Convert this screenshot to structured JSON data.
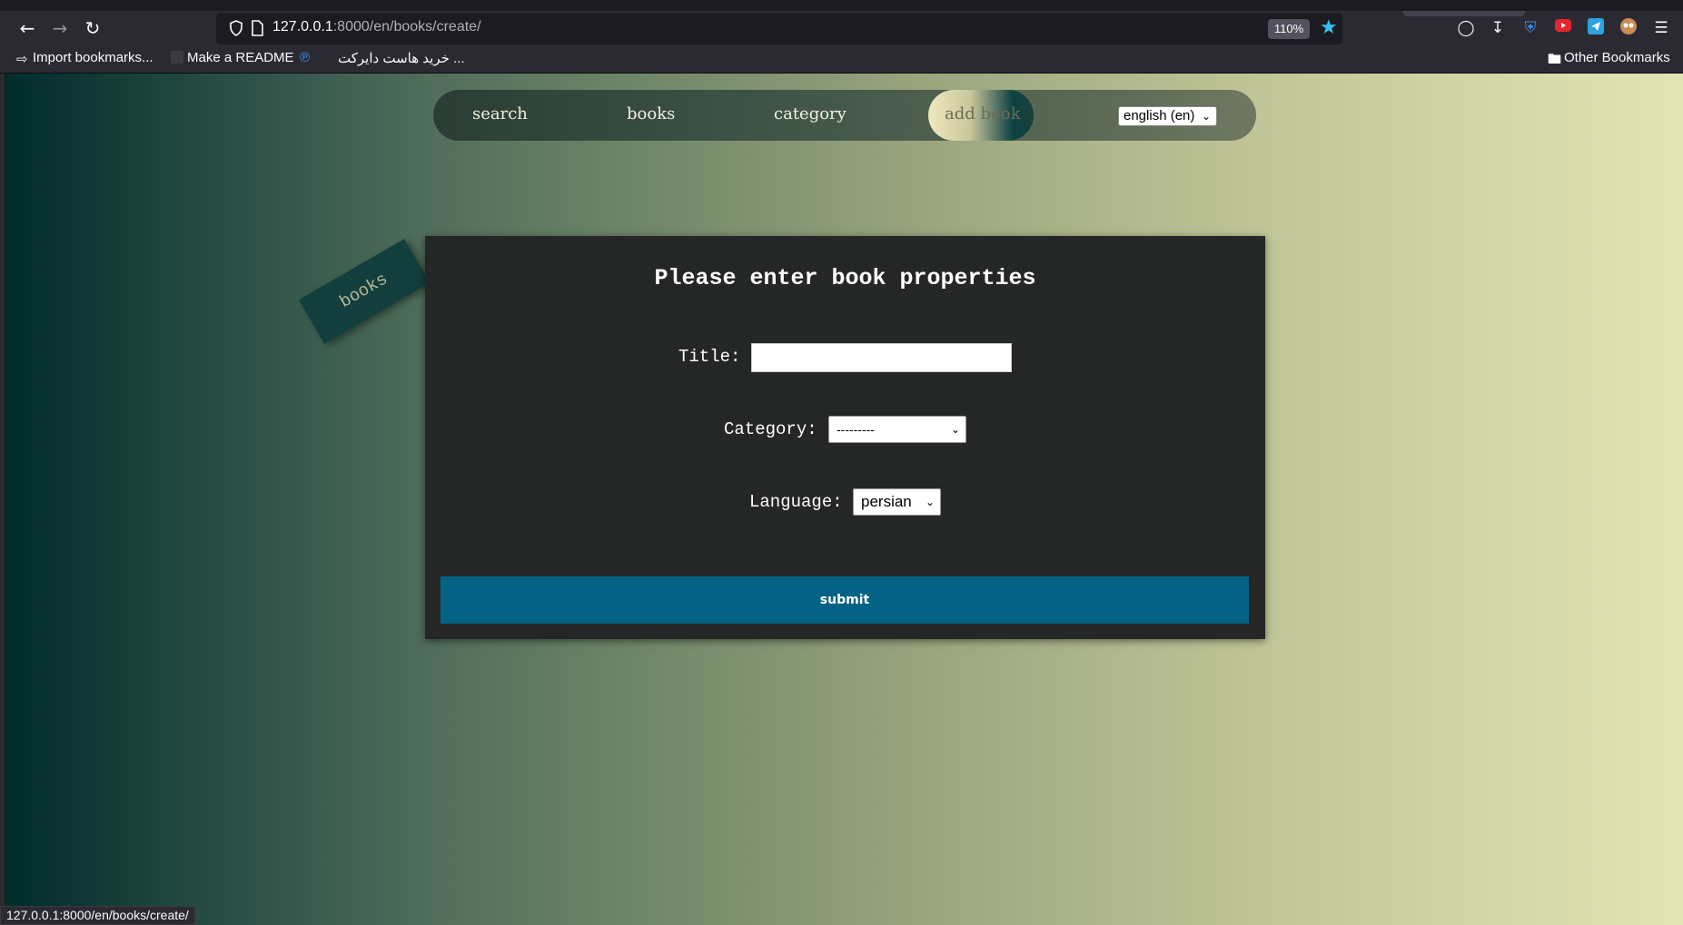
{
  "browser": {
    "url_host": "127.0.0.1",
    "url_rest": ":8000/en/books/create/",
    "zoom": "110%",
    "bookmarks": [
      {
        "label": "Import bookmarks..."
      },
      {
        "label": "Make a README"
      },
      {
        "label": "خرید هاست دایرکت ..."
      }
    ],
    "other_bookmarks": "Other Bookmarks",
    "status_url": "127.0.0.1:8000/en/books/create/"
  },
  "nav": {
    "search": "search",
    "books": "books",
    "category": "category",
    "add_book": "add book",
    "language_select": "english (en)"
  },
  "tag": "books",
  "form": {
    "title": "Please enter book properties",
    "title_label": "Title:",
    "title_value": "",
    "category_label": "Category:",
    "category_value": "---------",
    "language_label": "Language:",
    "language_value": "persian",
    "submit": "submit"
  },
  "colors": {
    "submit_bg": "#046285",
    "card_bg": "#242725",
    "star": "#2ec3f0"
  }
}
